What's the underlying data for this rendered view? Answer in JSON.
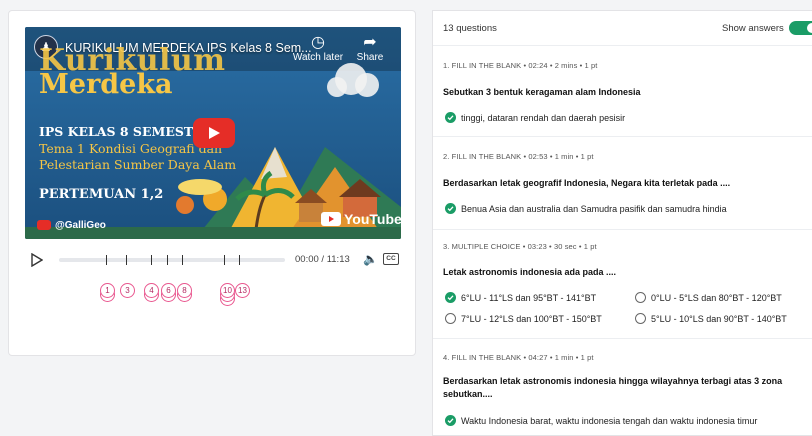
{
  "video": {
    "title": "KURIKULUM MERDEKA IPS Kelas 8 Sem...",
    "channel_initial": "♟",
    "watch_later": "Watch later",
    "share": "Share",
    "thumb_line1": "Kurikulum",
    "thumb_line2": "Merdeka",
    "thumb_ips": "IPS KELAS 8 SEMESTER 1",
    "thumb_tema": "Tema 1 Kondisi Geografi dan",
    "thumb_pelestarian": "Pelestarian Sumber Daya Alam",
    "thumb_pertemuan": "PERTEMUAN 1,2",
    "channel_handle": "@GalliGeo",
    "youtube_word": "YouTube",
    "time": "00:00 / 11:13",
    "cc": "CC",
    "markers": [
      {
        "label": "1",
        "stack": 2
      },
      {
        "label": "3",
        "stack": 1
      },
      {
        "label": "4",
        "stack": 2
      },
      {
        "label": "6",
        "stack": 2
      },
      {
        "label": "8",
        "stack": 2
      },
      {
        "label": "10",
        "stack": 3
      },
      {
        "label": "13",
        "stack": 1
      }
    ]
  },
  "panel": {
    "count": "13 questions",
    "show_answers": "Show answers",
    "show_answers_on": true,
    "questions": [
      {
        "meta": "1. FILL IN THE BLANK  •  02:24  •  2 mins  •  1 pt",
        "text": "Sebutkan 3 bentuk keragaman alam Indonesia",
        "answers": [
          "tinggi, dataran rendah dan daerah pesisir"
        ]
      },
      {
        "meta": "2. FILL IN THE BLANK  •  02:53  •  1 min  •  1 pt",
        "text": "Berdasarkan letak geografif Indonesia, Negara kita terletak pada ....",
        "answers": [
          "Benua Asia dan australia dan Samudra pasifik dan samudra hindia"
        ]
      },
      {
        "meta": "3. MULTIPLE CHOICE  •  03:23  •  30 sec  •  1 pt",
        "text": "Letak astronomis indonesia ada pada ....",
        "options": [
          {
            "text": "6°LU - 11°LS dan 95°BT - 141°BT",
            "correct": true
          },
          {
            "text": "0°LU - 5°LS dan 80°BT - 120°BT",
            "correct": false
          },
          {
            "text": "7°LU - 12°LS dan 100°BT - 150°BT",
            "correct": false
          },
          {
            "text": "5°LU - 10°LS dan 90°BT - 140°BT",
            "correct": false
          }
        ]
      },
      {
        "meta": "4. FILL IN THE BLANK  •  04:27  •  1 min  •  1 pt",
        "text": "Berdasarkan letak astronomis indonesia hingga wilayahnya terbagi atas 3 zona sebutkan....",
        "answers": [
          "Waktu Indonesia barat, waktu indonesia tengah dan waktu indonesia timur"
        ]
      }
    ]
  },
  "colors": {
    "accent_green": "#1a9c66",
    "marker_pink": "#e9578f",
    "youtube_red": "#e52d27",
    "thumb_yellow": "#f6c646"
  }
}
